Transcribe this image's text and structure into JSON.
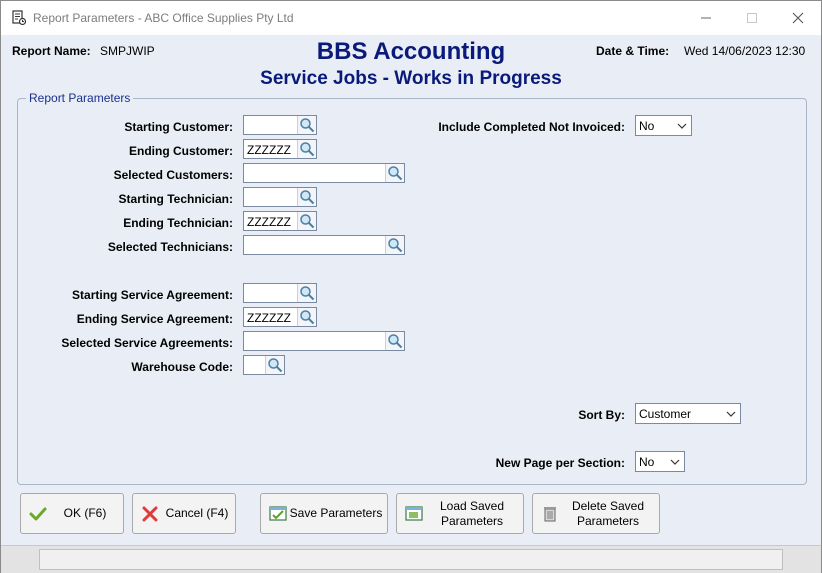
{
  "window": {
    "title": "Report Parameters - ABC Office Supplies Pty Ltd",
    "app_icon": "report-parameters-icon",
    "controls": [
      "minimize-icon",
      "maximize-icon",
      "close-icon"
    ]
  },
  "header": {
    "report_name_label": "Report Name:",
    "report_name_value": "SMPJWIP",
    "title": "BBS Accounting",
    "subtitle": "Service Jobs - Works in Progress",
    "datetime_label": "Date & Time:",
    "datetime_value": "Wed 14/06/2023 12:30"
  },
  "group": {
    "legend": "Report Parameters",
    "fields": {
      "starting_customer": {
        "label": "Starting Customer:",
        "value": ""
      },
      "ending_customer": {
        "label": "Ending Customer:",
        "value": "ZZZZZZ"
      },
      "selected_customers": {
        "label": "Selected Customers:",
        "value": ""
      },
      "starting_technician": {
        "label": "Starting Technician:",
        "value": ""
      },
      "ending_technician": {
        "label": "Ending Technician:",
        "value": "ZZZZZZ"
      },
      "selected_technicians": {
        "label": "Selected Technicians:",
        "value": ""
      },
      "starting_service_agreement": {
        "label": "Starting Service Agreement:",
        "value": ""
      },
      "ending_service_agreement": {
        "label": "Ending Service Agreement:",
        "value": "ZZZZZZ"
      },
      "selected_service_agreements": {
        "label": "Selected Service Agreements:",
        "value": ""
      },
      "warehouse_code": {
        "label": "Warehouse Code:",
        "value": ""
      }
    },
    "include_completed": {
      "label": "Include Completed Not Invoiced:",
      "value": "No"
    },
    "sort_by": {
      "label": "Sort By:",
      "value": "Customer"
    },
    "new_page": {
      "label": "New Page per Section:",
      "value": "No"
    }
  },
  "buttons": {
    "ok": "OK (F6)",
    "cancel": "Cancel (F4)",
    "save": "Save Parameters",
    "load_line1": "Load Saved",
    "load_line2": "Parameters",
    "delete_line1": "Delete Saved",
    "delete_line2": "Parameters"
  },
  "colors": {
    "title": "#0a1a7a",
    "legend": "#1a2f8f",
    "background": "#e9eef6"
  }
}
